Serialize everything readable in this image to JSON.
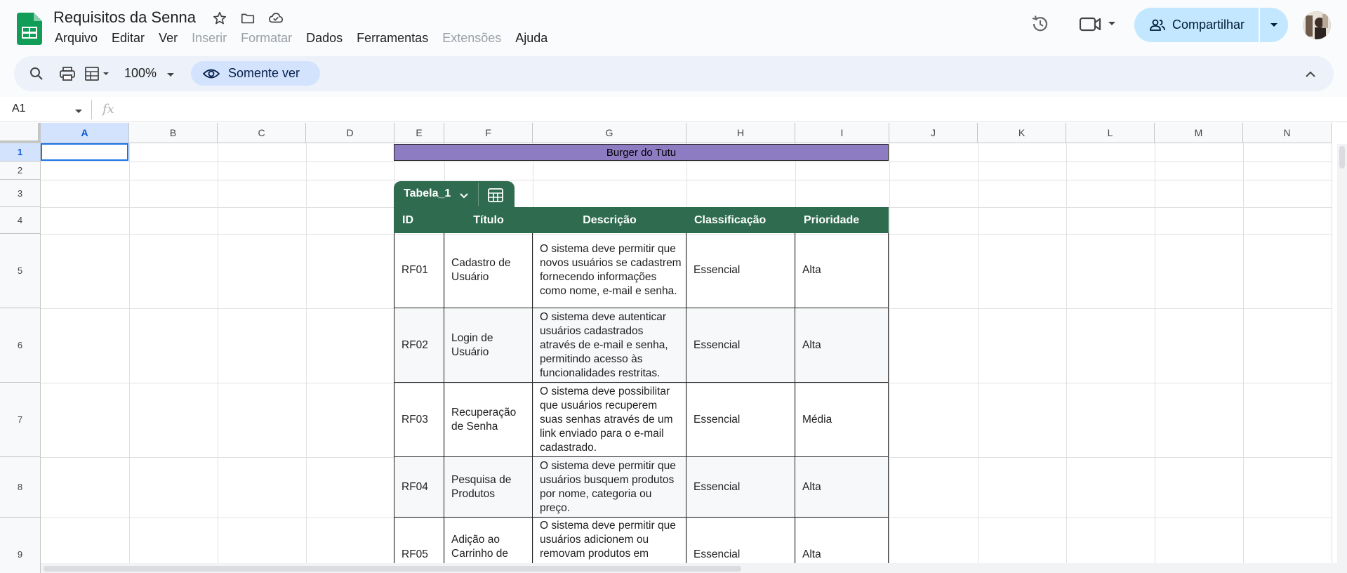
{
  "header": {
    "title": "Requisitos da Senna",
    "menu": [
      "Arquivo",
      "Editar",
      "Ver",
      "Inserir",
      "Formatar",
      "Dados",
      "Ferramentas",
      "Extensões",
      "Ajuda"
    ],
    "share_label": "Compartilhar"
  },
  "toolbar": {
    "zoom": "100%",
    "view_only_label": "Somente ver"
  },
  "formula_bar": {
    "name_box": "A1",
    "fx_label": "fx",
    "formula": ""
  },
  "grid": {
    "columns": [
      "A",
      "B",
      "C",
      "D",
      "E",
      "F",
      "G",
      "H",
      "I",
      "J",
      "K",
      "L",
      "M",
      "N"
    ],
    "rows": [
      "1",
      "2",
      "3",
      "4",
      "5",
      "6",
      "7",
      "8",
      "9"
    ],
    "selected_cell": "A1"
  },
  "sheet": {
    "banner_title": "Burger do Tutu",
    "table_name": "Tabela_1",
    "headers": [
      "ID",
      "Título",
      "Descrição",
      "Classificação",
      "Prioridade"
    ],
    "rows": [
      {
        "id": "RF01",
        "titulo": "Cadastro de Usuário",
        "descricao": "O sistema deve permitir que novos usuários se cadastrem fornecendo informações como nome, e-mail e senha.",
        "classificacao": "Essencial",
        "prioridade": "Alta"
      },
      {
        "id": "RF02",
        "titulo": "Login de Usuário",
        "descricao": "O sistema deve autenticar usuários cadastrados através de e-mail e senha, permitindo acesso às funcionalidades restritas.",
        "classificacao": "Essencial",
        "prioridade": "Alta"
      },
      {
        "id": "RF03",
        "titulo": "Recuperação de Senha",
        "descricao": "O sistema deve possibilitar que usuários recuperem suas senhas através de um link enviado para o e-mail cadastrado.",
        "classificacao": "Essencial",
        "prioridade": "Média"
      },
      {
        "id": "RF04",
        "titulo": "Pesquisa de Produtos",
        "descricao": "O sistema deve permitir que usuários busquem produtos por nome, categoria ou preço.",
        "classificacao": "Essencial",
        "prioridade": "Alta"
      },
      {
        "id": "RF05",
        "titulo": "Adição ao Carrinho de",
        "descricao": "O sistema deve permitir que usuários adicionem ou removam produtos em",
        "classificacao": "Essencial",
        "prioridade": "Alta"
      }
    ]
  },
  "colors": {
    "table_header": "#2f6c4f",
    "banner": "#8e7cc3",
    "share_button": "#c2e7ff",
    "selection": "#1a73e8"
  }
}
